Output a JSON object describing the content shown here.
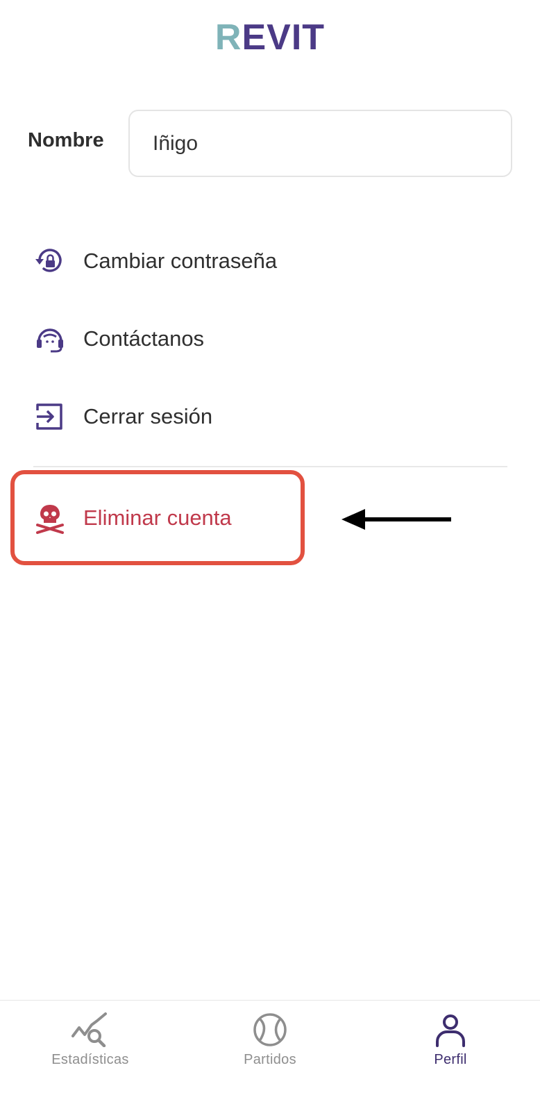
{
  "header": {
    "logo_first": "R",
    "logo_rest": "EVIT"
  },
  "profile": {
    "name_label": "Nombre",
    "name_value": "Iñigo"
  },
  "menu": {
    "items": [
      {
        "label": "Cambiar contraseña",
        "icon": "lock-reset-icon"
      },
      {
        "label": "Contáctanos",
        "icon": "headset-icon"
      },
      {
        "label": "Cerrar sesión",
        "icon": "logout-icon"
      },
      {
        "label": "Eliminar cuenta",
        "icon": "skull-crossbones-icon"
      }
    ]
  },
  "tabbar": {
    "tabs": [
      {
        "label": "Estadísticas",
        "icon": "stats-search-icon"
      },
      {
        "label": "Partidos",
        "icon": "tennis-ball-icon"
      },
      {
        "label": "Perfil",
        "icon": "user-icon",
        "active": true
      }
    ]
  },
  "colors": {
    "brand_purple": "#4b3a86",
    "brand_teal": "#7fb3b8",
    "danger": "#c0394b",
    "highlight_border": "#e25140"
  }
}
